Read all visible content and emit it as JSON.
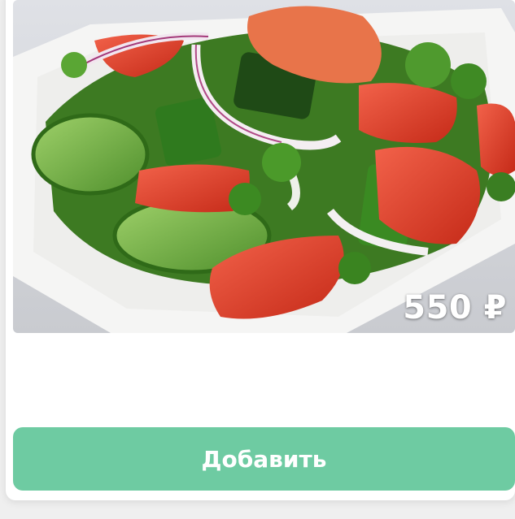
{
  "product": {
    "image": "cucumber-tomato-onion-salad-photo",
    "price": "550 ₽"
  },
  "actions": {
    "add_label": "Добавить"
  },
  "colors": {
    "accent": "#6ecba2",
    "card_background": "#ffffff",
    "page_background": "#efefef"
  }
}
